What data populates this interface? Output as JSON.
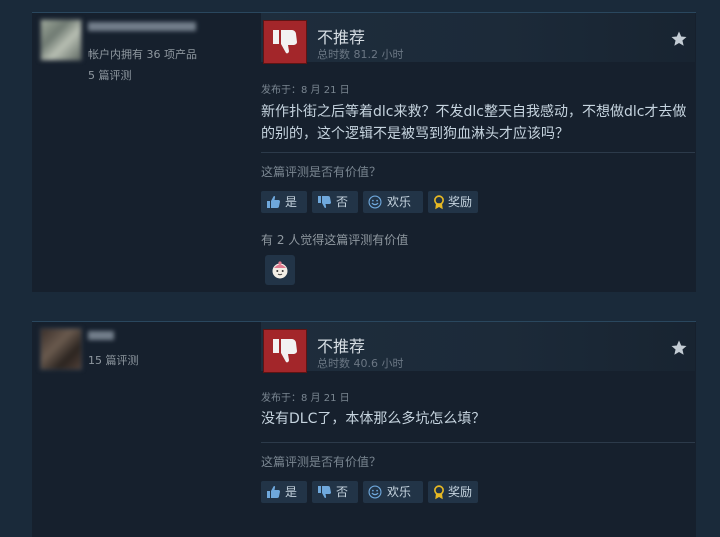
{
  "reviews": [
    {
      "author": {
        "owned_text": "帐户内拥有 36 项产品",
        "reviews_text": "5 篇评测"
      },
      "verdict": "不推荐",
      "hours": "总时数 81.2 小时",
      "posted": "发布于：8 月 21 日",
      "text": "新作扑街之后等着dlc来救？不发dlc整天自我感动，不想做dlc才去做的别的，这个逻辑不是被骂到狗血淋头才应该吗？",
      "helpful_question": "这篇评测是否有价值？",
      "buttons": {
        "yes": "是",
        "no": "否",
        "funny": "欢乐",
        "award": "奖励"
      },
      "helpful_count_text": "有 2 人觉得这篇评测有价值"
    },
    {
      "author": {
        "reviews_text": "15 篇评测"
      },
      "verdict": "不推荐",
      "hours": "总时数 40.6 小时",
      "posted": "发布于：8 月 21 日",
      "text": "没有DLC了，本体那么多坑怎么填？",
      "helpful_question": "这篇评测是否有价值？",
      "buttons": {
        "yes": "是",
        "no": "否",
        "funny": "欢乐",
        "award": "奖励"
      }
    }
  ],
  "icons": {
    "verdict": "thumbs-down-icon",
    "corner": "star-icon",
    "yes": "thumbs-up-icon",
    "no": "thumbs-down-icon",
    "funny": "smile-icon",
    "award": "award-ribbon-icon"
  },
  "colors": {
    "background": "#1a2a3a",
    "card": "#16202d",
    "not_recommended": "#a3262a",
    "vote_button": "#223447",
    "award_gold": "#e8b923"
  }
}
